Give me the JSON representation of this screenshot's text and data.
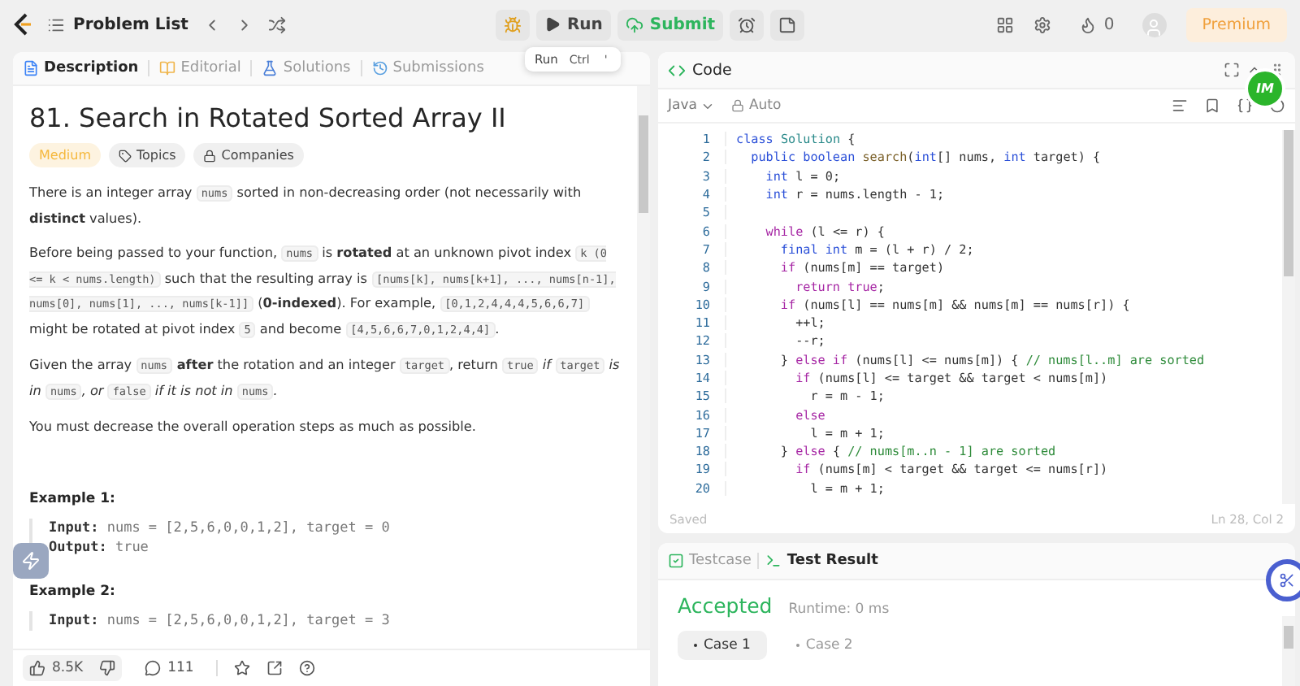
{
  "top_bar": {
    "nav_label": "Problem List",
    "run_label": "Run",
    "submit_label": "Submit",
    "streak": "0",
    "premium_label": "Premium"
  },
  "tooltip": {
    "label": "Run",
    "keys": [
      "Ctrl",
      "'"
    ]
  },
  "description_tabs": [
    {
      "label": "Description",
      "selected": true
    },
    {
      "label": "Editorial",
      "selected": false
    },
    {
      "label": "Solutions",
      "selected": false
    },
    {
      "label": "Submissions",
      "selected": false
    }
  ],
  "problem": {
    "title": "81. Search in Rotated Sorted Array II",
    "tags": [
      {
        "label": "Medium",
        "kind": "difficulty"
      },
      {
        "label": "Topics",
        "kind": "topics"
      },
      {
        "label": "Companies",
        "kind": "companies"
      }
    ],
    "paragraphs": [
      [
        {
          "text": "There is an integer array ",
          "kind": "text"
        },
        {
          "text": "nums",
          "kind": "code"
        },
        {
          "text": " sorted in non-decreasing order (not necessarily with ",
          "kind": "text"
        },
        {
          "text": "distinct",
          "kind": "bold"
        },
        {
          "text": " values).",
          "kind": "text"
        }
      ],
      [
        {
          "text": "Before being passed to your function, ",
          "kind": "text"
        },
        {
          "text": "nums",
          "kind": "code"
        },
        {
          "text": " is ",
          "kind": "text"
        },
        {
          "text": "rotated",
          "kind": "bold"
        },
        {
          "text": " at an unknown pivot index ",
          "kind": "text"
        },
        {
          "text": "k (0 <= k < nums.length)",
          "kind": "code"
        },
        {
          "text": " such that the resulting array is ",
          "kind": "text"
        },
        {
          "text": "[nums[k], nums[k+1], ..., nums[n-1], nums[0], nums[1], ..., nums[k-1]]",
          "kind": "code"
        },
        {
          "text": " (",
          "kind": "text"
        },
        {
          "text": "0-indexed",
          "kind": "bold"
        },
        {
          "text": "). For example, ",
          "kind": "text"
        },
        {
          "text": "[0,1,2,4,4,4,5,6,6,7]",
          "kind": "code"
        },
        {
          "text": " might be rotated at pivot index ",
          "kind": "text"
        },
        {
          "text": "5",
          "kind": "code"
        },
        {
          "text": " and become ",
          "kind": "text"
        },
        {
          "text": "[4,5,6,6,7,0,1,2,4,4]",
          "kind": "code"
        },
        {
          "text": ".",
          "kind": "text"
        }
      ],
      [
        {
          "text": "Given the array ",
          "kind": "text"
        },
        {
          "text": "nums",
          "kind": "code"
        },
        {
          "text": " after",
          "kind": "bold"
        },
        {
          "text": " the rotation and an integer ",
          "kind": "text"
        },
        {
          "text": "target",
          "kind": "code"
        },
        {
          "text": ", return ",
          "kind": "text"
        },
        {
          "text": "true",
          "kind": "code"
        },
        {
          "text": " if ",
          "kind": "italic"
        },
        {
          "text": "target",
          "kind": "code"
        },
        {
          "text": " is in ",
          "kind": "italic"
        },
        {
          "text": "nums",
          "kind": "code"
        },
        {
          "text": ", or ",
          "kind": "italic"
        },
        {
          "text": "false",
          "kind": "code"
        },
        {
          "text": " if it is not in ",
          "kind": "italic"
        },
        {
          "text": "nums",
          "kind": "code"
        },
        {
          "text": ".",
          "kind": "italic"
        }
      ],
      [
        {
          "text": "You must decrease the overall operation steps as much as possible.",
          "kind": "text"
        }
      ]
    ],
    "examples": [
      {
        "title": "Example 1:",
        "lines": [
          {
            "label": "Input:",
            "value": "nums = [2,5,6,0,0,1,2], target = 0"
          },
          {
            "label": "Output:",
            "value": "true"
          }
        ]
      },
      {
        "title": "Example 2:",
        "lines": [
          {
            "label": "Input:",
            "value": "nums = [2,5,6,0,0,1,2], target = 3"
          }
        ]
      }
    ]
  },
  "footer": {
    "likes": "8.5K",
    "comments": "111"
  },
  "code_panel": {
    "title": "Code",
    "language": "Java",
    "mode": "Auto",
    "status": "Saved",
    "cursor": "Ln 28, Col 2",
    "badge": "IM",
    "lines": [
      {
        "number": "1",
        "segments": [
          {
            "text": "class ",
            "kind": "kw"
          },
          {
            "text": "Solution",
            "kind": "cls"
          },
          {
            "text": " {",
            "kind": "plain"
          }
        ]
      },
      {
        "number": "2",
        "segments": [
          {
            "text": "  public boolean ",
            "kind": "kw"
          },
          {
            "text": "search",
            "kind": "fn"
          },
          {
            "text": "(",
            "kind": "plain"
          },
          {
            "text": "int",
            "kind": "kw"
          },
          {
            "text": "[] nums, ",
            "kind": "plain"
          },
          {
            "text": "int",
            "kind": "kw"
          },
          {
            "text": " target) {",
            "kind": "plain"
          }
        ]
      },
      {
        "number": "3",
        "segments": [
          {
            "text": "    int",
            "kind": "kw"
          },
          {
            "text": " l = 0;",
            "kind": "plain"
          }
        ]
      },
      {
        "number": "4",
        "segments": [
          {
            "text": "    int",
            "kind": "kw"
          },
          {
            "text": " r = nums.length - 1;",
            "kind": "plain"
          }
        ]
      },
      {
        "number": "5"
      },
      {
        "number": "6",
        "segments": [
          {
            "text": "    while",
            "kind": "ctrl"
          },
          {
            "text": " (l <= r) {",
            "kind": "plain"
          }
        ]
      },
      {
        "number": "7",
        "segments": [
          {
            "text": "      final int",
            "kind": "kw"
          },
          {
            "text": " m = (l + r) / 2;",
            "kind": "plain"
          }
        ]
      },
      {
        "number": "8",
        "segments": [
          {
            "text": "      if",
            "kind": "ctrl"
          },
          {
            "text": " (nums[m] == target)",
            "kind": "plain"
          }
        ]
      },
      {
        "number": "9",
        "segments": [
          {
            "text": "        return true",
            "kind": "ctrl"
          },
          {
            "text": ";",
            "kind": "plain"
          }
        ]
      },
      {
        "number": "10",
        "segments": [
          {
            "text": "      if",
            "kind": "ctrl"
          },
          {
            "text": " (nums[l] == nums[m] && nums[m] == nums[r]) {",
            "kind": "plain"
          }
        ]
      },
      {
        "number": "11",
        "segments": [
          {
            "text": "        ++l;",
            "kind": "plain"
          }
        ]
      },
      {
        "number": "12",
        "segments": [
          {
            "text": "        --r;",
            "kind": "plain"
          }
        ]
      },
      {
        "number": "13",
        "segments": [
          {
            "text": "      } ",
            "kind": "plain"
          },
          {
            "text": "else if",
            "kind": "ctrl"
          },
          {
            "text": " (nums[l] <= nums[m]) { ",
            "kind": "plain"
          },
          {
            "text": "// nums[l..m] are sorted",
            "kind": "comment"
          }
        ]
      },
      {
        "number": "14",
        "segments": [
          {
            "text": "        if",
            "kind": "ctrl"
          },
          {
            "text": " (nums[l] <= target && target < nums[m])",
            "kind": "plain"
          }
        ]
      },
      {
        "number": "15",
        "segments": [
          {
            "text": "          r = m - 1;",
            "kind": "plain"
          }
        ]
      },
      {
        "number": "16",
        "segments": [
          {
            "text": "        else",
            "kind": "ctrl"
          }
        ]
      },
      {
        "number": "17",
        "segments": [
          {
            "text": "          l = m + 1;",
            "kind": "plain"
          }
        ]
      },
      {
        "number": "18",
        "segments": [
          {
            "text": "      } ",
            "kind": "plain"
          },
          {
            "text": "else",
            "kind": "ctrl"
          },
          {
            "text": " { ",
            "kind": "plain"
          },
          {
            "text": "// nums[m..n - 1] are sorted",
            "kind": "comment"
          }
        ]
      },
      {
        "number": "19",
        "segments": [
          {
            "text": "        if",
            "kind": "ctrl"
          },
          {
            "text": " (nums[m] < target && target <= nums[r])",
            "kind": "plain"
          }
        ]
      },
      {
        "number": "20",
        "segments": [
          {
            "text": "          l = m + 1;",
            "kind": "plain"
          }
        ]
      }
    ]
  },
  "result_panel": {
    "tabs": [
      {
        "label": "Testcase",
        "selected": false
      },
      {
        "label": "Test Result",
        "selected": true
      }
    ],
    "verdict": "Accepted",
    "runtime": "Runtime: 0 ms",
    "cases": [
      {
        "label": "Case 1",
        "selected": true
      },
      {
        "label": "Case 2",
        "selected": false
      }
    ]
  }
}
